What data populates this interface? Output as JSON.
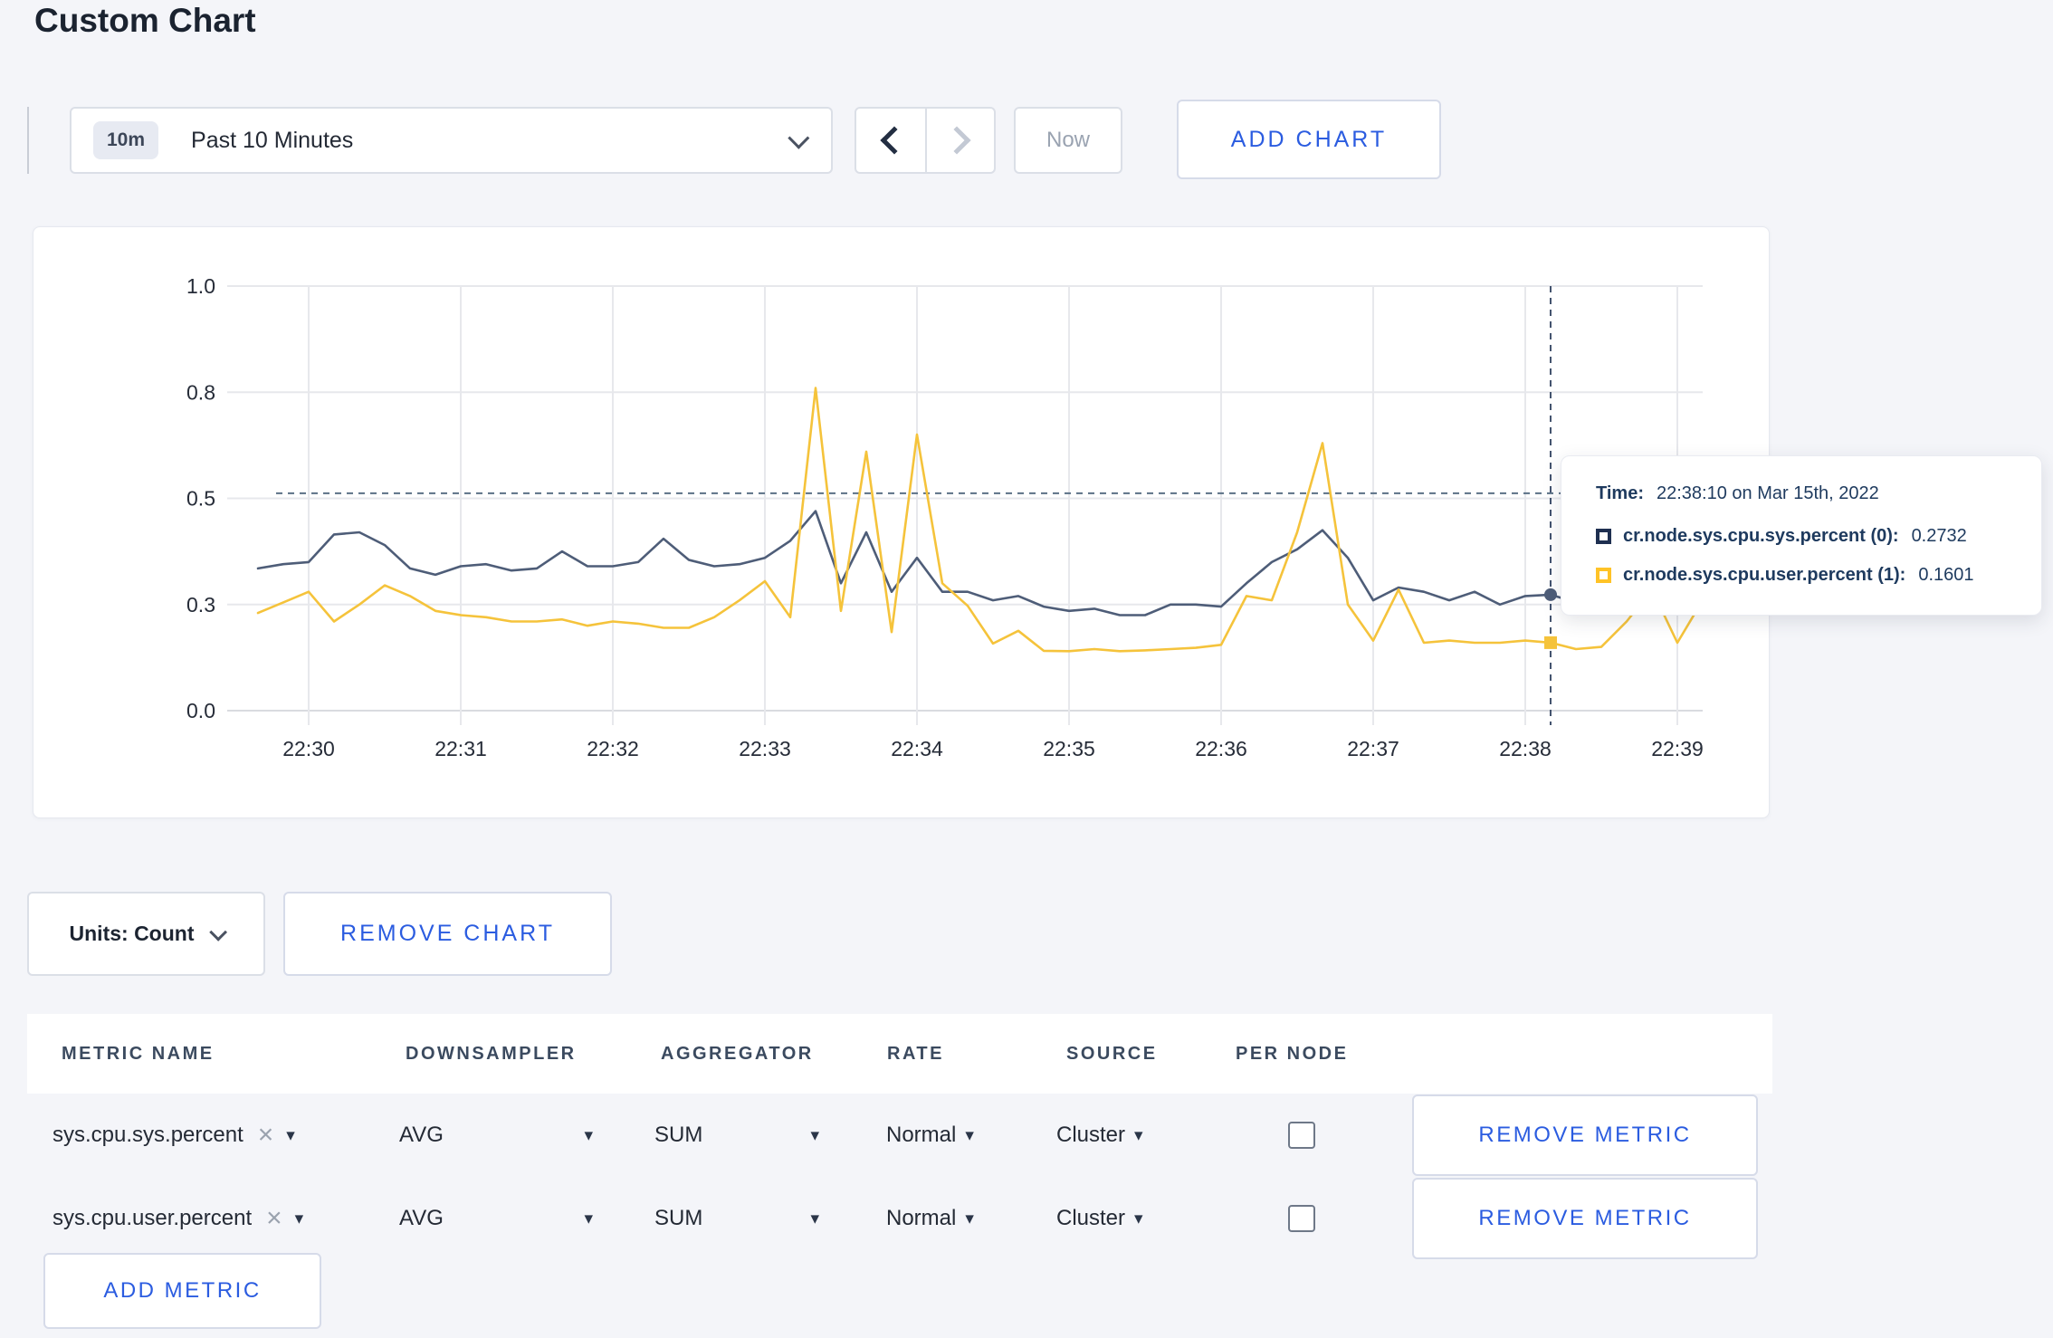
{
  "page": {
    "title": "Custom Chart",
    "background_color": "#f4f5f9",
    "accent_blue": "#2b5ce0"
  },
  "toolbar": {
    "range_badge": "10m",
    "range_label": "Past 10 Minutes",
    "now_label": "Now",
    "add_chart_label": "ADD CHART"
  },
  "chart_controls": {
    "units_label": "Units: Count",
    "remove_chart_label": "REMOVE CHART"
  },
  "chart_data": {
    "type": "line",
    "x_start": "22:29:40",
    "x_interval_seconds": 10,
    "x_ticks": [
      "22:30",
      "22:31",
      "22:32",
      "22:33",
      "22:34",
      "22:35",
      "22:36",
      "22:37",
      "22:38",
      "22:39"
    ],
    "y_tick_labels": [
      "0.0",
      "0.3",
      "0.5",
      "0.8",
      "1.0"
    ],
    "y_tick_values": [
      0,
      0.25,
      0.5,
      0.75,
      1.0
    ],
    "ylim": [
      0,
      1
    ],
    "grid": true,
    "gridline_color": "#e7e8ec",
    "baseline_color": "#d9dbe0",
    "series": [
      {
        "name": "cr.node.sys.cpu.sys.percent",
        "color": "#4e5d78",
        "values": [
          0.335,
          0.345,
          0.35,
          0.415,
          0.42,
          0.39,
          0.335,
          0.32,
          0.34,
          0.345,
          0.33,
          0.335,
          0.375,
          0.34,
          0.34,
          0.35,
          0.405,
          0.355,
          0.34,
          0.345,
          0.36,
          0.4,
          0.47,
          0.3,
          0.42,
          0.28,
          0.36,
          0.28,
          0.28,
          0.26,
          0.27,
          0.245,
          0.235,
          0.24,
          0.225,
          0.225,
          0.25,
          0.25,
          0.245,
          0.3,
          0.35,
          0.38,
          0.425,
          0.36,
          0.26,
          0.29,
          0.28,
          0.26,
          0.28,
          0.25,
          0.27,
          0.2732,
          0.255,
          0.27,
          0.29,
          0.275,
          0.29,
          0.3
        ]
      },
      {
        "name": "cr.node.sys.cpu.user.percent",
        "color": "#f5c33b",
        "values": [
          0.23,
          0.255,
          0.28,
          0.21,
          0.25,
          0.295,
          0.27,
          0.235,
          0.225,
          0.22,
          0.21,
          0.21,
          0.215,
          0.2,
          0.21,
          0.205,
          0.195,
          0.195,
          0.22,
          0.26,
          0.305,
          0.22,
          0.76,
          0.235,
          0.61,
          0.185,
          0.65,
          0.3,
          0.247,
          0.158,
          0.188,
          0.141,
          0.14,
          0.145,
          0.14,
          0.142,
          0.145,
          0.148,
          0.155,
          0.27,
          0.26,
          0.42,
          0.63,
          0.25,
          0.165,
          0.285,
          0.16,
          0.165,
          0.16,
          0.16,
          0.165,
          0.1601,
          0.145,
          0.15,
          0.21,
          0.285,
          0.16,
          0.26
        ]
      }
    ],
    "crosshair": {
      "index": 51,
      "time": "22:38:10",
      "hline_value": 0.512,
      "line_color": "#44546f",
      "values": [
        0.2732,
        0.1601
      ]
    }
  },
  "tooltip": {
    "time_label": "Time:",
    "time_value": "22:38:10 on Mar 15th, 2022",
    "rows": [
      {
        "name": "cr.node.sys.cpu.sys.percent (0):",
        "value": "0.2732",
        "swatch_color": "#1e2f50"
      },
      {
        "name": "cr.node.sys.cpu.user.percent (1):",
        "value": "0.1601",
        "swatch_color": "#ffc327"
      }
    ]
  },
  "metrics_table": {
    "columns": [
      "METRIC NAME",
      "DOWNSAMPLER",
      "AGGREGATOR",
      "RATE",
      "SOURCE",
      "PER NODE"
    ],
    "rows": [
      {
        "metric_name": "sys.cpu.sys.percent",
        "downsampler": "AVG",
        "aggregator": "SUM",
        "rate": "Normal",
        "source": "Cluster",
        "per_node_checked": false,
        "remove_label": "REMOVE METRIC"
      },
      {
        "metric_name": "sys.cpu.user.percent",
        "downsampler": "AVG",
        "aggregator": "SUM",
        "rate": "Normal",
        "source": "Cluster",
        "per_node_checked": false,
        "remove_label": "REMOVE METRIC"
      }
    ],
    "add_metric_label": "ADD METRIC"
  }
}
